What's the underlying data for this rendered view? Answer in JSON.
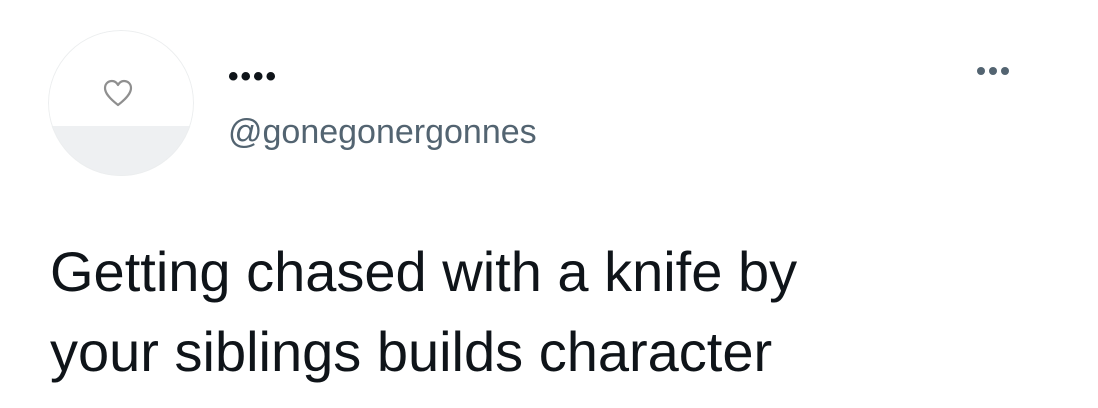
{
  "tweet": {
    "author": {
      "display_name": "••••",
      "handle": "@gonegonergonnes",
      "avatar_icon": "heart-icon"
    },
    "more_icon": "more-horizontal-icon",
    "text_lines": [
      "Getting chased with a knife by",
      "your siblings builds character"
    ]
  },
  "colors": {
    "text_primary": "#0f1419",
    "text_secondary": "#536471",
    "background": "#ffffff"
  }
}
